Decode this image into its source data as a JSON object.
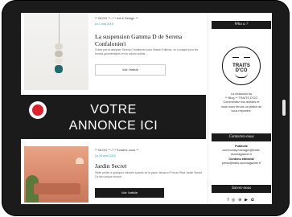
{
  "posts": [
    {
      "category": "** BLOG ** / ** Art & Design **",
      "date": "Le 1 mai 2019",
      "title": "La suspension Gamma D de Serena Confalonieri",
      "excerpt": "Créée par la designer Serena Confalonieri pour Mason Editions, on a craqué pour les formes géométriques et les coloris subtils...",
      "button": "Voir l'article"
    },
    {
      "category": "** BLOG ** / ** Évadez-vous **",
      "date": "Le 28 avril 2019",
      "title": "Jardin Secret",
      "excerpt": "Visite privée à quelques minutes à pieds de la place Jemaa el Fna du Riad Jardin Secret. Ce lieu unique rénové...",
      "button": "Voir l'article"
    }
  ],
  "ad": {
    "line1": "VOTRE",
    "line2": "ANNONCE ICI"
  },
  "sidebar": {
    "who_heading": "Who a ?",
    "logo_text_line1": "TRAITS",
    "logo_text_line2": "D'CO",
    "about_line1": "La rédaction du",
    "about_line2": "** Blog ** TRAITS D'CO",
    "about_line3": "Commentez nos articles et",
    "about_line4": "nous nous ferons un plaisir de",
    "about_line5": "vous répondre.",
    "contact_heading": "Contactez-nous",
    "pub_label": "Publicité",
    "pub_email_1": "community.manager@traits-",
    "pub_email_2": "dcomagazine.fr",
    "edit_label": "Contenu éditorial",
    "edit_email": "press@traits-dcomagazine.fr",
    "follow_heading": "Suivez-nous",
    "social_icons": "f ◎ ⊕ ▶ ✿"
  },
  "colors": {
    "frame": "#1b1b1b",
    "accent_teal": "#2aa6a0",
    "ad_dot": "#e0202a"
  }
}
